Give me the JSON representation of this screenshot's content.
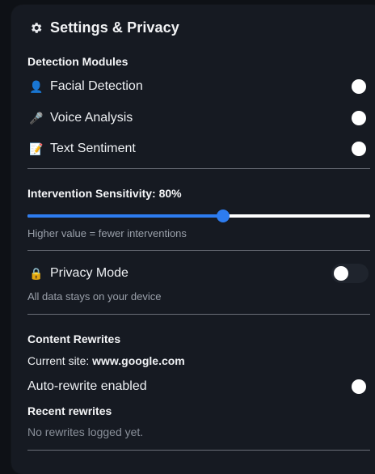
{
  "header": {
    "title": "Settings & Privacy",
    "icon": "gear-icon"
  },
  "detection": {
    "section_label": "Detection Modules",
    "modules": [
      {
        "emoji": "👤",
        "icon": "person-icon",
        "label": "Facial Detection",
        "enabled": true
      },
      {
        "emoji": "🎤",
        "icon": "microphone-icon",
        "label": "Voice Analysis",
        "enabled": true
      },
      {
        "emoji": "📝",
        "icon": "memo-icon",
        "label": "Text Sentiment",
        "enabled": true
      }
    ]
  },
  "sensitivity": {
    "label": "Intervention Sensitivity: 80%",
    "value": 0.57,
    "accent": "#2d7cf0",
    "help": "Higher value = fewer interventions"
  },
  "privacy": {
    "emoji": "🔒",
    "icon": "lock-icon",
    "label": "Privacy Mode",
    "enabled": false,
    "help": "All data stays on your device"
  },
  "rewrites": {
    "section_label": "Content Rewrites",
    "site_prefix": "Current site: ",
    "site": "www.google.com",
    "auto_label": "Auto-rewrite enabled",
    "auto_enabled": true,
    "recent_label": "Recent rewrites",
    "empty_text": "No rewrites logged yet."
  }
}
